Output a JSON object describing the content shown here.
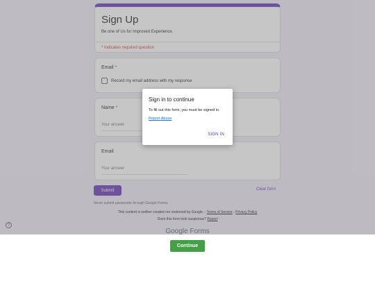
{
  "form": {
    "title": "Sign Up",
    "description": "Be one of Us for Improved Experience.",
    "required_note": "* Indicates required question"
  },
  "questions": [
    {
      "label": "Email",
      "required_marker": "*",
      "checkbox_label": "Record my email address with my response"
    },
    {
      "label": "Name",
      "required_marker": "*",
      "placeholder": "Your answer"
    },
    {
      "label": "Email",
      "placeholder": "Your answer"
    }
  ],
  "actions": {
    "submit_label": "Submit",
    "clear_label": "Clear form"
  },
  "footer": {
    "password_warning": "Never submit passwords through Google Forms.",
    "disclaimer_prefix": "This content is neither created nor endorsed by Google. -",
    "terms_link": "Terms of Service",
    "separator": "-",
    "privacy_link": "Privacy Policy",
    "suspicious_prefix": "Does this form look suspicious?",
    "report_link": "Report",
    "logo_text": "Google Forms"
  },
  "help_icon": {
    "glyph": "?",
    "icon": "help-icon"
  },
  "dialog": {
    "title": "Sign in to continue",
    "body": "To fill out this form, you must be signed in.",
    "report_link": "Report Abuse",
    "action": "SIGN IN"
  },
  "bottom_bar": {
    "continue_label": "Continue"
  },
  "colors": {
    "accent": "#673ab7",
    "continue": "#43a047",
    "required": "#d93025",
    "link": "#1a73e8"
  }
}
